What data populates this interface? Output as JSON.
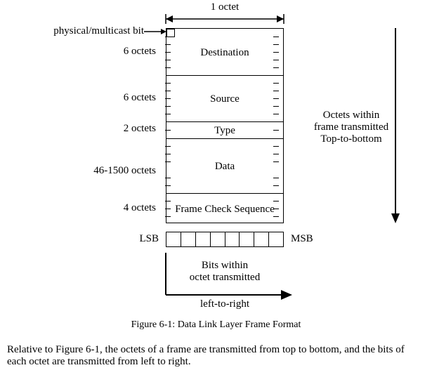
{
  "width_label": "1 octet",
  "pm_label": "physical/multicast bit",
  "frame": {
    "segments": [
      {
        "size_label": "6 octets",
        "name": "Destination"
      },
      {
        "size_label": "6 octets",
        "name": "Source"
      },
      {
        "size_label": "2 octets",
        "name": "Type"
      },
      {
        "size_label": "46-1500 octets",
        "name": "Data"
      },
      {
        "size_label": "4 octets",
        "name": "Frame Check Sequence"
      }
    ]
  },
  "right_note": {
    "line1": "Octets within",
    "line2": "frame transmitted",
    "line3": "Top-to-bottom"
  },
  "lsb": "LSB",
  "msb": "MSB",
  "bits_note": {
    "line1": "Bits within",
    "line2": "octet transmitted",
    "line3": "left-to-right"
  },
  "figure_caption": "Figure 6-1: Data Link Layer Frame Format",
  "body_text": "Relative to Figure 6-1, the octets of a frame are transmitted from top to bottom, and the bits of each octet are transmitted from left to right."
}
